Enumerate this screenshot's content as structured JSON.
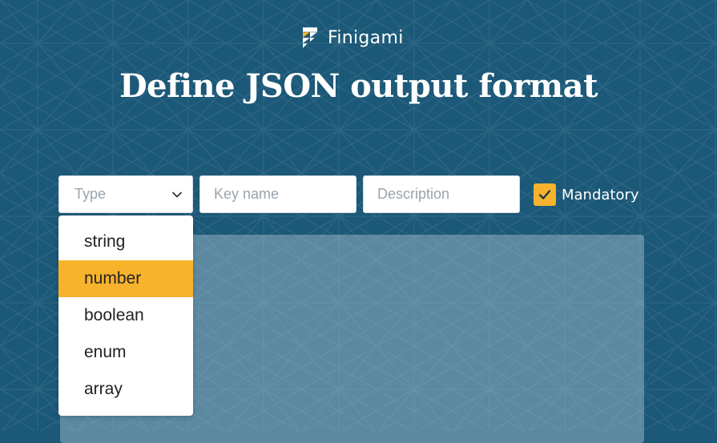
{
  "brand": {
    "name": "Finigami"
  },
  "heading": "Define JSON output format",
  "form": {
    "type_placeholder": "Type",
    "key_placeholder": "Key name",
    "description_placeholder": "Description",
    "mandatory_label": "Mandatory",
    "mandatory_checked": true
  },
  "type_dropdown": {
    "options": [
      "string",
      "number",
      "boolean",
      "enum",
      "array"
    ],
    "highlighted": "number"
  },
  "colors": {
    "background": "#1c5877",
    "accent": "#f7b32b",
    "text_on_dark": "#ffffff"
  },
  "icons": [
    "finigami-logo-icon",
    "chevron-down-icon",
    "checkmark-icon"
  ]
}
